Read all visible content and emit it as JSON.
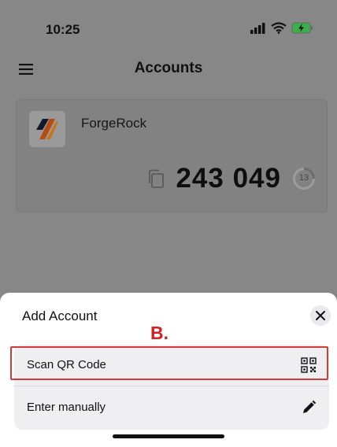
{
  "status": {
    "time": "10:25"
  },
  "header": {
    "title": "Accounts"
  },
  "account": {
    "issuer": "ForgeRock",
    "code": "243 049",
    "timer": "13"
  },
  "sheet": {
    "title": "Add Account",
    "marker": "B.",
    "options": [
      {
        "label": "Scan QR Code",
        "icon": "qr-code-icon"
      },
      {
        "label": "Enter manually",
        "icon": "pencil-icon"
      }
    ]
  },
  "colors": {
    "marker_red": "#d21f1f",
    "overlay": "#878787",
    "sheet_bg": "#ffffff"
  }
}
